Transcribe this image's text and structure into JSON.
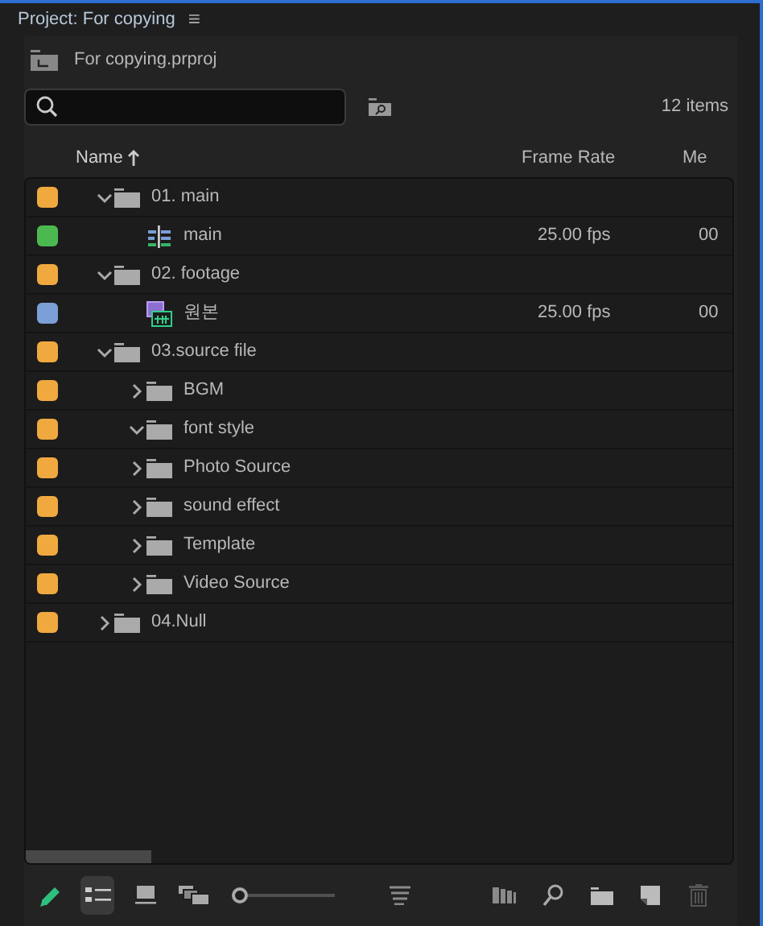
{
  "panel": {
    "title": "Project: For copying",
    "menu_glyph": "≡"
  },
  "project_file": "For copying.prproj",
  "item_count": "12 items",
  "columns": [
    {
      "label": "Name",
      "sorted": true
    },
    {
      "label": "Frame Rate",
      "sorted": false
    },
    {
      "label": "Me",
      "sorted": false
    }
  ],
  "items": [
    {
      "kind": "folder",
      "name": "01. main",
      "color": "#f0a93f",
      "expanded": true,
      "children": [
        {
          "kind": "sequence",
          "name": "main",
          "color": "#4cb950",
          "frame_rate": "25.00 fps",
          "media_start": "00"
        }
      ]
    },
    {
      "kind": "folder",
      "name": "02. footage",
      "color": "#f0a93f",
      "expanded": true,
      "children": [
        {
          "kind": "clip",
          "name": "원본",
          "color": "#7b9fd6",
          "frame_rate": "25.00 fps",
          "media_start": "00"
        }
      ]
    },
    {
      "kind": "folder",
      "name": "03.source file",
      "color": "#f0a93f",
      "expanded": true,
      "children": [
        {
          "kind": "folder",
          "name": "BGM",
          "color": "#f0a93f",
          "expanded": false
        },
        {
          "kind": "folder",
          "name": "font style",
          "color": "#f0a93f",
          "expanded": true
        },
        {
          "kind": "folder",
          "name": "Photo Source",
          "color": "#f0a93f",
          "expanded": false
        },
        {
          "kind": "folder",
          "name": "sound effect",
          "color": "#f0a93f",
          "expanded": false
        },
        {
          "kind": "folder",
          "name": "Template",
          "color": "#f0a93f",
          "expanded": false
        },
        {
          "kind": "folder",
          "name": "Video Source",
          "color": "#f0a93f",
          "expanded": false
        }
      ]
    },
    {
      "kind": "folder",
      "name": "04.Null",
      "color": "#f0a93f",
      "expanded": false
    }
  ],
  "toolbar": [
    {
      "kind": "pencil",
      "selected": false
    },
    {
      "kind": "list-view",
      "selected": true
    },
    {
      "kind": "icon-view",
      "selected": false
    },
    {
      "kind": "freeform-view",
      "selected": false
    },
    {
      "kind": "zoom-slider",
      "level": 0
    },
    {
      "kind": "sort",
      "selected": false
    },
    {
      "kind": "automate",
      "selected": false
    },
    {
      "kind": "find",
      "selected": false
    },
    {
      "kind": "new-bin",
      "selected": false
    },
    {
      "kind": "new-item",
      "selected": false
    },
    {
      "kind": "trash",
      "selected": false
    }
  ]
}
